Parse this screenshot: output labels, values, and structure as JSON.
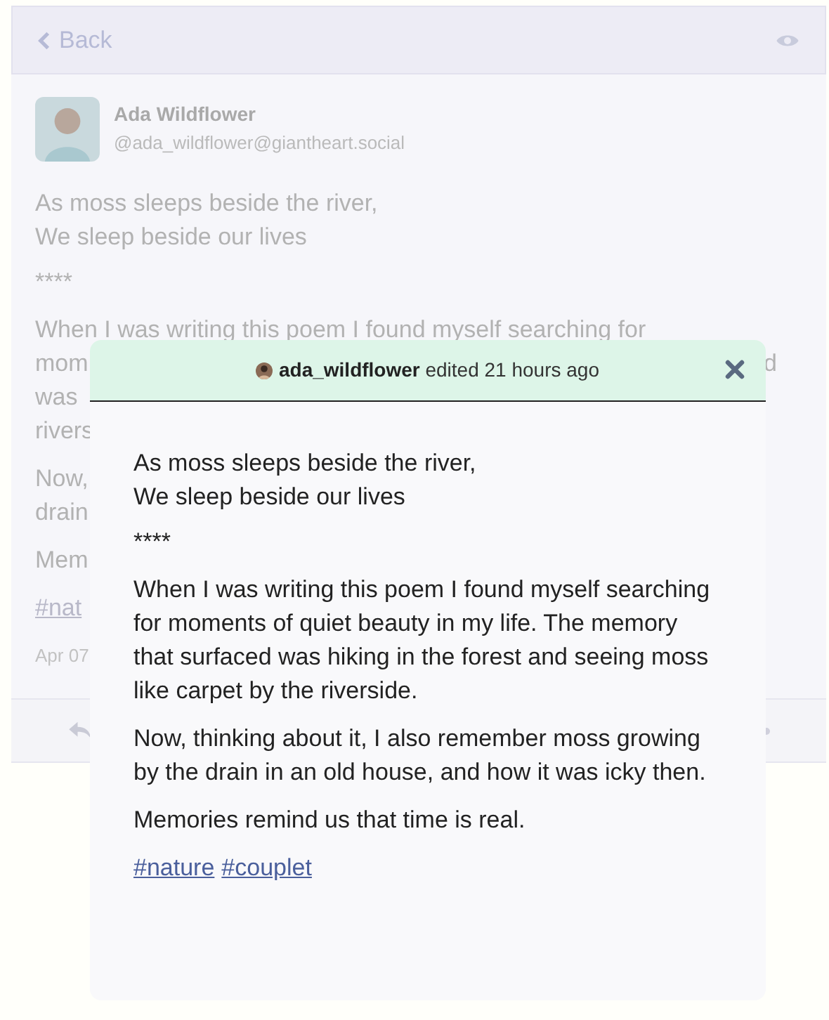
{
  "header": {
    "back_label": "Back"
  },
  "post": {
    "author": {
      "name": "Ada Wildflower",
      "handle": "@ada_wildflower@giantheart.social"
    },
    "verse": [
      "As moss sleeps beside the river,",
      "We sleep beside our lives"
    ],
    "separator": "****",
    "paragraphs": [
      [
        {
          "left": "When I was writing this poem I found myself searching for"
        },
        {
          "left": "mom",
          "right": "d"
        },
        {
          "left": "was"
        },
        {
          "left": "rivers"
        }
      ],
      [
        {
          "left": "Now,"
        },
        {
          "left": "drain"
        }
      ],
      [
        {
          "left": "Mem"
        }
      ]
    ],
    "tag_fragment": "#nat",
    "date": "Apr 07"
  },
  "modal": {
    "user": "ada_wildflower",
    "action": "edited 21 hours ago",
    "verse": [
      "As moss sleeps beside the river,",
      "We sleep beside our lives"
    ],
    "separator": "****",
    "paragraphs": [
      "When I was writing this poem I found myself searching for moments of quiet beauty in my life. The memory that surfaced was hiking in the forest and seeing moss like carpet by the riverside.",
      "Now, thinking about it, I also remember moss growing by the drain in an old house, and how it was icky then.",
      "Memories remind us that time is real."
    ],
    "tags": [
      "#nature",
      "#couplet"
    ]
  }
}
